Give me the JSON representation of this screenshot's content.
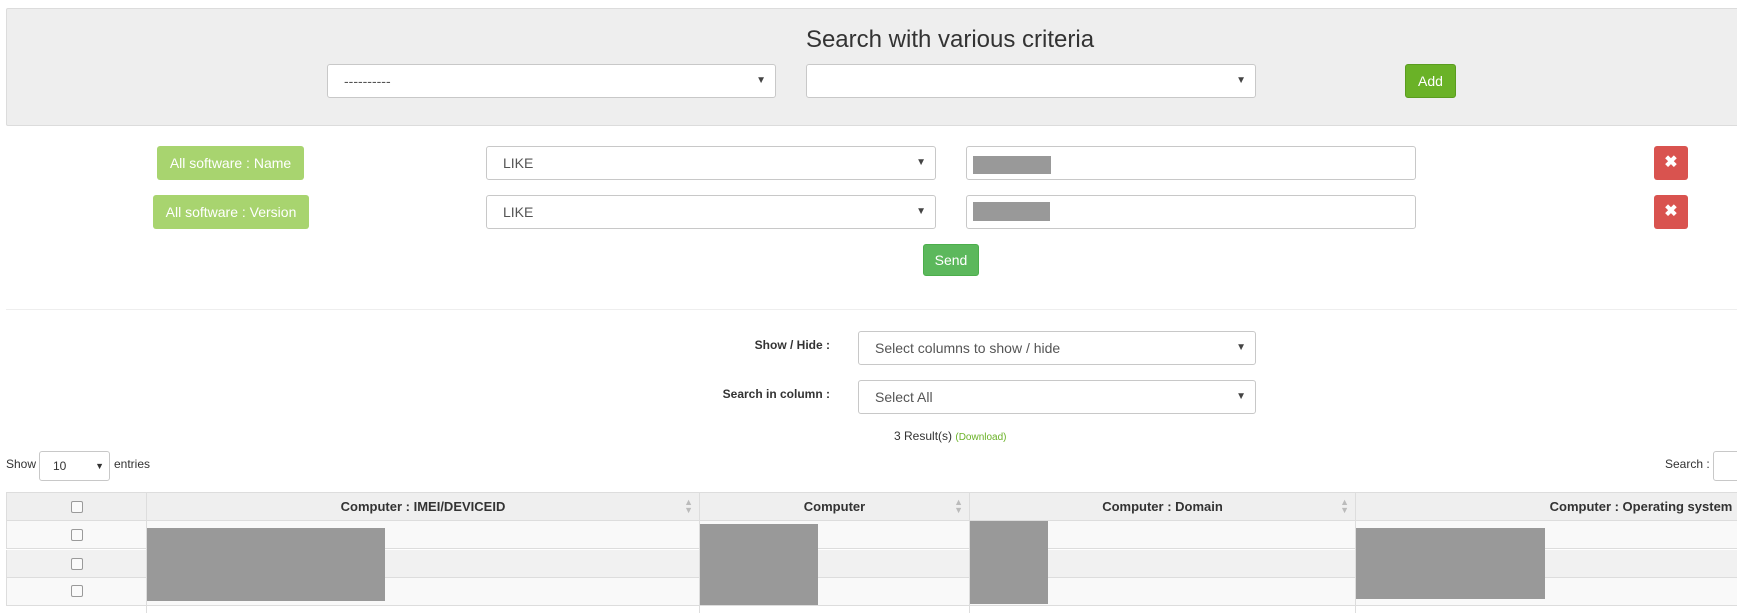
{
  "criteria_panel": {
    "title": "Search with various criteria",
    "field_select_value": "----------",
    "operator_select_value": "",
    "add_label": "Add"
  },
  "criteria_rows": [
    {
      "label": "All software : Name",
      "operator": "LIKE"
    },
    {
      "label": "All software : Version",
      "operator": "LIKE"
    }
  ],
  "send_label": "Send",
  "controls": {
    "show_hide_label": "Show / Hide :",
    "show_hide_value": "Select columns to show / hide",
    "search_in_column_label": "Search in column :",
    "search_in_column_value": "Select All",
    "results_text": "3 Result(s)",
    "download_text": "(Download)",
    "show_label": "Show",
    "entries_value": "10",
    "entries_label": "entries",
    "search_label": "Search :"
  },
  "table": {
    "columns": [
      "Computer : IMEI/DEVICEID",
      "Computer",
      "Computer : Domain",
      "Computer : Operating system"
    ],
    "row_count": 3
  },
  "icons": {
    "caret": "caret-down-icon",
    "remove": "close-icon",
    "sort": "sort-icon",
    "checkbox": "checkbox-icon"
  },
  "colors": {
    "add_button": "#6ab227",
    "criteria_label": "#a8d46f",
    "remove_button": "#d9534f",
    "send_button": "#5cb85c",
    "redaction": "#999999"
  }
}
